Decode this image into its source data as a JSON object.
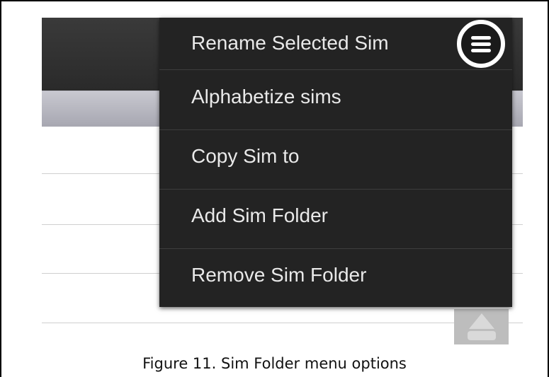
{
  "menu": {
    "items": [
      {
        "label": "Rename Selected Sim"
      },
      {
        "label": "Alphabetize sims"
      },
      {
        "label": "Copy Sim to"
      },
      {
        "label": "Add Sim Folder"
      },
      {
        "label": "Remove Sim Folder"
      }
    ]
  },
  "icons": {
    "menu_button": "hamburger-menu-icon",
    "scroll_button": "scroll-up-icon"
  },
  "caption": "Figure 11. Sim Folder menu options"
}
